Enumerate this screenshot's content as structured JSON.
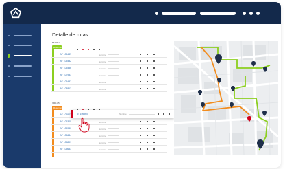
{
  "page": {
    "title": "Detalle de rutas"
  },
  "sidebar": {
    "items": [
      "",
      "",
      "",
      "",
      ""
    ],
    "active_index": 2
  },
  "routes": {
    "groups": [
      {
        "label": "MVAP-11",
        "tab": "Resumen",
        "color": "#8ccf1f",
        "header_dots": [
          "#1f1f1f",
          "#d0021b",
          "#d0021b",
          "#1f1f1f",
          "#1f1f1f"
        ],
        "rows": [
          {
            "code": "N° 105489",
            "label": "Nombre"
          },
          {
            "code": "N° 105432",
            "label": "Nombre"
          },
          {
            "code": "N° 105456",
            "label": "Nombre"
          },
          {
            "code": "N° 107983",
            "label": "Nombre"
          },
          {
            "code": "N° 105432",
            "label": "Nombre"
          },
          {
            "code": "N° 108813",
            "label": "Nombre"
          }
        ]
      },
      {
        "label": "VRD-05",
        "tab": "Resumen",
        "color": "#f28c1e",
        "header_dots": [
          "#1f1f1f",
          "#d0021b",
          "#1f1f1f",
          "#1f1f1f",
          "#1f1f1f"
        ],
        "rows": [
          {
            "code": "N° 105503",
            "label": "Nombre"
          },
          {
            "code": "N° 105305",
            "label": "Nombre"
          },
          {
            "code": "N° 105980",
            "label": "Nombre"
          },
          {
            "code": "N° 105684",
            "label": "Nombre"
          },
          {
            "code": "N° 105891",
            "label": "Nombre"
          },
          {
            "code": "N° 105653",
            "label": "Nombre"
          }
        ]
      }
    ],
    "selected_row": {
      "code": "N° 105960",
      "label": "Nombre"
    }
  },
  "colors": {
    "topbar": "#13294b",
    "sidebar": "#1a3a6b",
    "route_green": "#8ccf1f",
    "route_orange": "#f28c1e",
    "marker": "#1f2f4a",
    "marker_red": "#d0021b"
  },
  "icons": {
    "logo": "brand-logo-icon",
    "cursor": "hand-pointer-icon",
    "marker": "map-pin-icon"
  }
}
